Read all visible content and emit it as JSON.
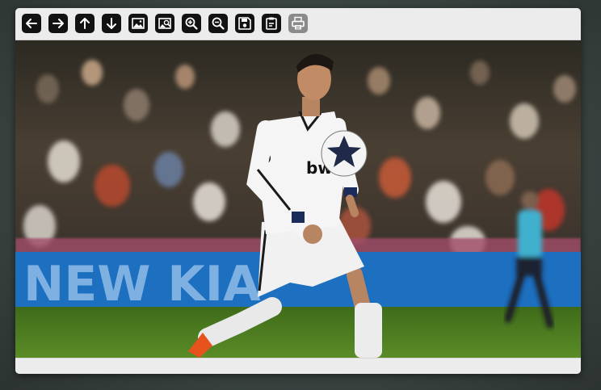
{
  "viewer": {
    "toolbar": {
      "buttons": [
        {
          "name": "previous",
          "icon": "arrow-left-icon"
        },
        {
          "name": "next",
          "icon": "arrow-right-icon"
        },
        {
          "name": "rotate-up",
          "icon": "arrow-up-icon"
        },
        {
          "name": "rotate-down",
          "icon": "arrow-down-icon"
        },
        {
          "name": "fit-image",
          "icon": "image-icon"
        },
        {
          "name": "actual-size",
          "icon": "image-zoom-icon"
        },
        {
          "name": "zoom-in",
          "icon": "zoom-in-icon"
        },
        {
          "name": "zoom-out",
          "icon": "zoom-out-icon"
        },
        {
          "name": "save",
          "icon": "save-icon"
        },
        {
          "name": "clipboard",
          "icon": "clipboard-icon"
        },
        {
          "name": "print",
          "icon": "print-icon",
          "disabled": true
        }
      ]
    },
    "photo": {
      "banner_text": "NEW KIA",
      "jersey_logo": "bw"
    },
    "colors": {
      "toolbar_bg": "#ececec",
      "button_bg": "#121212",
      "button_disabled_bg": "#8a8a8a",
      "pitch_green": "#4a7a1f",
      "banner_blue": "#1d6fc0"
    }
  }
}
